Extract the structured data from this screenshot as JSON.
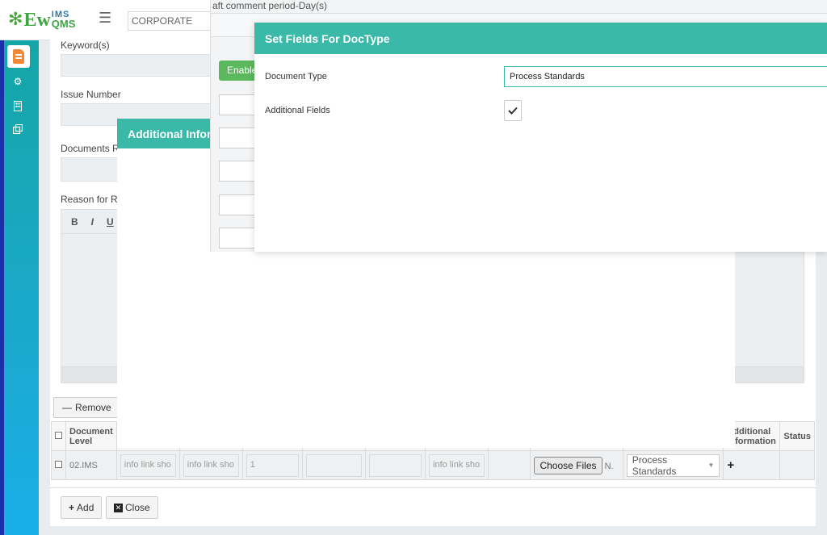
{
  "app": {
    "logo_ew": "Ew",
    "logo_ims": "IMS",
    "logo_qms": "QMS",
    "org_select": "CORPORATE"
  },
  "background_form": {
    "keywords_label": "Keyword(s)",
    "issue_number_label": "Issue Number",
    "documents_label": "Documents R",
    "reason_label": "Reason for R",
    "editor_tools": [
      "B",
      "I",
      "U"
    ],
    "remove_label": "Remove",
    "table": {
      "headers": [
        "Document Level",
        "",
        "",
        "",
        "",
        "",
        "",
        "",
        "",
        "Additional Information",
        "Status"
      ],
      "row": {
        "level": "02.IMS",
        "info1": "info link sho",
        "info2": "info link sho",
        "number": "1",
        "info3": "info link sho",
        "choose_files": "Choose Files",
        "files_note": "N.",
        "doc_type": "Process Standards"
      }
    },
    "add_label": "Add",
    "close_label": "Close"
  },
  "additional_info_modal": {
    "title": "Additional Inform"
  },
  "middle_panel": {
    "title": "aft comment period-Day(s)",
    "enable_label": "Enable"
  },
  "set_fields_modal": {
    "title": "Set Fields For DocType",
    "document_type_label": "Document Type",
    "document_type_value": "Process Standards",
    "additional_fields_label": "Additional Fields",
    "additional_fields_checked": true
  },
  "colors": {
    "accent": "#3ab8a8",
    "sidebar_top": "#14a6a6",
    "sidebar_bottom": "#19aee8",
    "enable_button": "#5cb85c"
  }
}
